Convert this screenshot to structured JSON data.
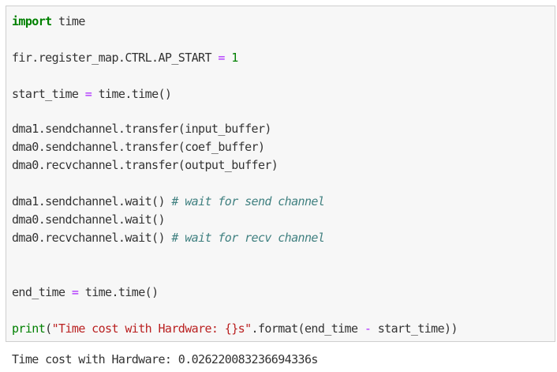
{
  "code_cell": {
    "line1": {
      "keyword": "import",
      "rest": " time"
    },
    "line2": {
      "prefix": "fir.register_map.CTRL.AP_START ",
      "op": "=",
      "space": " ",
      "number": "1"
    },
    "line3": {
      "prefix": "start_time ",
      "op": "=",
      "rest": " time.time()"
    },
    "line4": {
      "text": "dma1.sendchannel.transfer(input_buffer)"
    },
    "line5": {
      "text": "dma0.sendchannel.transfer(coef_buffer)"
    },
    "line6": {
      "text": "dma0.recvchannel.transfer(output_buffer)"
    },
    "line7": {
      "code": "dma1.sendchannel.wait() ",
      "comment": "# wait for send channel"
    },
    "line8": {
      "text": "dma0.sendchannel.wait()"
    },
    "line9": {
      "code": "dma0.recvchannel.wait() ",
      "comment": "# wait for recv channel"
    },
    "line10": {
      "prefix": "end_time ",
      "op": "=",
      "rest": " time.time()"
    },
    "line11": {
      "builtin": "print",
      "open": "(",
      "string": "\"Time cost with Hardware: {}s\"",
      "mid": ".format(end_time ",
      "op": "-",
      "end": " start_time))"
    }
  },
  "output": {
    "text": "Time cost with Hardware: 0.026220083236694336s"
  }
}
